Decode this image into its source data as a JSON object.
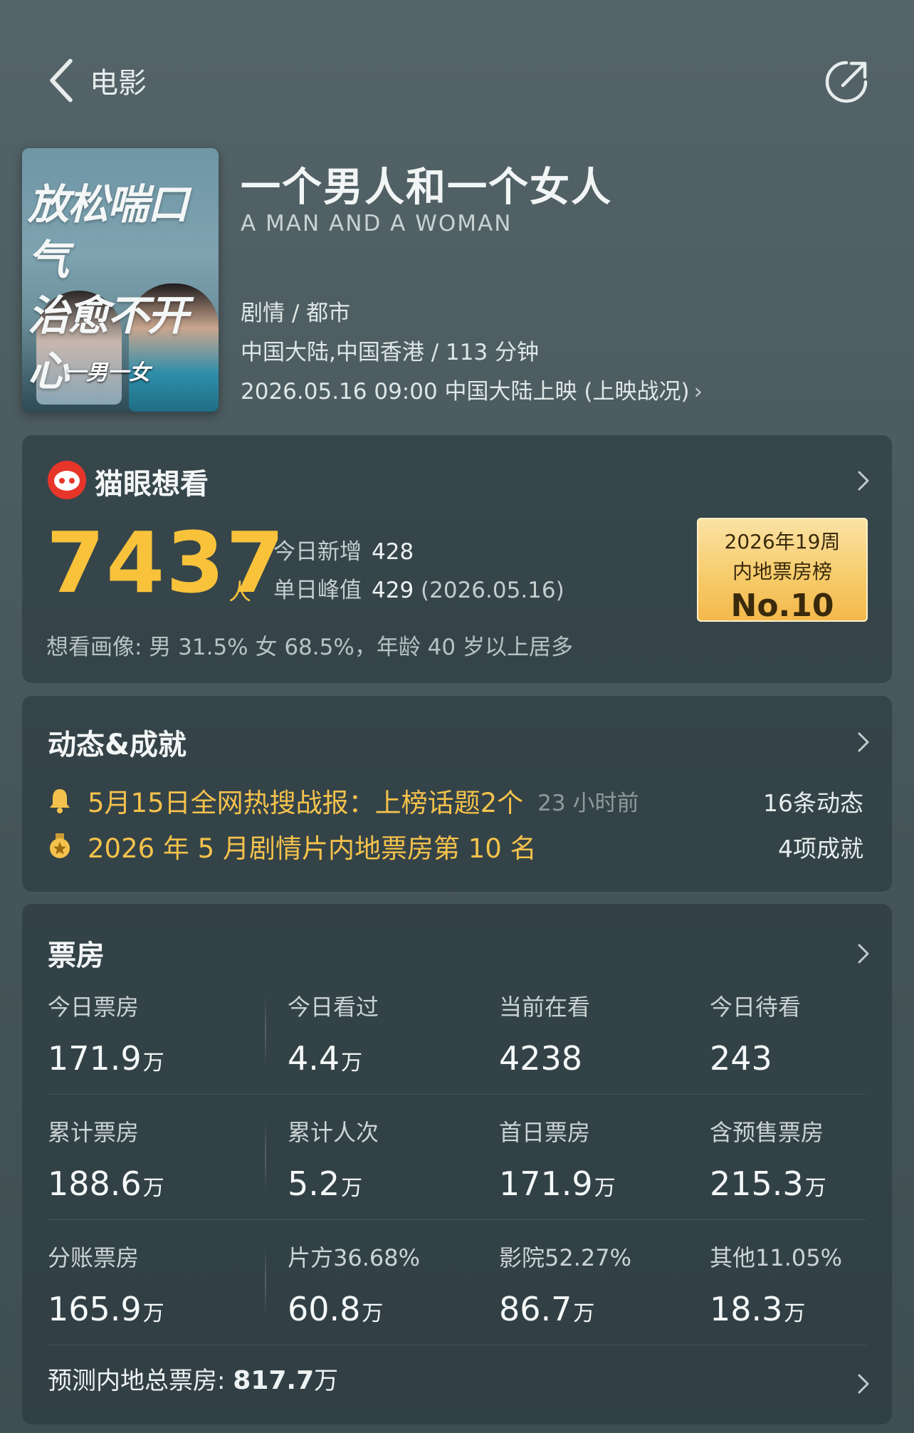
{
  "header": {
    "back_label": "电影"
  },
  "poster": {
    "tagline_line1": "放松喘口气",
    "tagline_line2": "治愈不开心",
    "logo_text": "一男一女"
  },
  "movie": {
    "title": "一个男人和一个女人",
    "english_title": "A MAN AND A WOMAN",
    "genre": "剧情 / 都市",
    "region_duration": "中国大陆,中国香港 / 113 分钟",
    "release": "2026.05.16 09:00 中国大陆上映 (上映战况)"
  },
  "want_to_see": {
    "title": "猫眼想看",
    "count": "7437",
    "unit": "人",
    "today_new_label": "今日新增",
    "today_new_value": "428",
    "peak_label": "单日峰值",
    "peak_value": "429",
    "peak_date": "(2026.05.16)",
    "demographics": "想看画像: 男 31.5%  女 68.5%，年龄 40 岁以上居多",
    "rank_week": "2026年19周",
    "rank_board": "内地票房榜",
    "rank_no": "No.10"
  },
  "news": {
    "title": "动态&成就",
    "item1_text": "5月15日全网热搜战报：上榜话题2个",
    "item1_time": "23 小时前",
    "item1_right": "16条动态",
    "item2_text": "2026 年 5 月剧情片内地票房第 10 名",
    "item2_right": "4项成就"
  },
  "box_office": {
    "title": "票房",
    "cells": [
      {
        "label": "今日票房",
        "value": "171.9",
        "unit": "万"
      },
      {
        "label": "今日看过",
        "value": "4.4",
        "unit": "万"
      },
      {
        "label": "当前在看",
        "value": "4238",
        "unit": ""
      },
      {
        "label": "今日待看",
        "value": "243",
        "unit": ""
      },
      {
        "label": "累计票房",
        "value": "188.6",
        "unit": "万"
      },
      {
        "label": "累计人次",
        "value": "5.2",
        "unit": "万"
      },
      {
        "label": "首日票房",
        "value": "171.9",
        "unit": "万"
      },
      {
        "label": "含预售票房",
        "value": "215.3",
        "unit": "万"
      },
      {
        "label": "分账票房",
        "value": "165.9",
        "unit": "万"
      },
      {
        "label": "片方36.68%",
        "value": "60.8",
        "unit": "万"
      },
      {
        "label": "影院52.27%",
        "value": "86.7",
        "unit": "万"
      },
      {
        "label": "其他11.05%",
        "value": "18.3",
        "unit": "万"
      }
    ],
    "forecast_label": "预测内地总票房:",
    "forecast_value": "817.7",
    "forecast_unit": "万"
  },
  "colors": {
    "accent": "#f8c23a",
    "news_text": "#f4c24c",
    "maoyan_red": "#e8352a"
  }
}
